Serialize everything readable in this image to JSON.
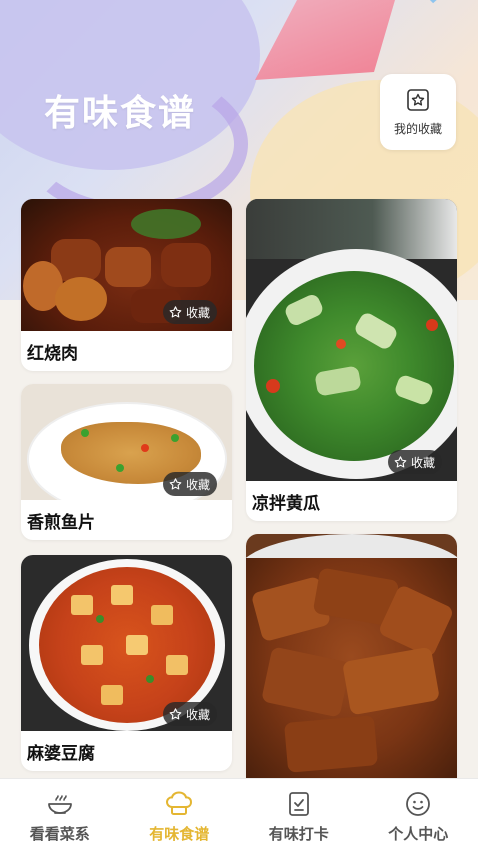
{
  "header": {
    "title": "有味食谱",
    "favorites_label": "我的收藏"
  },
  "recipes": [
    {
      "name": "红烧肉",
      "badge": "收藏"
    },
    {
      "name": "凉拌黄瓜",
      "badge": "收藏"
    },
    {
      "name": "香煎鱼片",
      "badge": "收藏"
    },
    {
      "name": "麻婆豆腐",
      "badge": "收藏"
    },
    {
      "name": "",
      "badge": ""
    }
  ],
  "tabs": [
    {
      "label": "看看菜系",
      "icon": "bowl-icon",
      "active": false
    },
    {
      "label": "有味食谱",
      "icon": "chef-hat-icon",
      "active": true
    },
    {
      "label": "有味打卡",
      "icon": "checklist-icon",
      "active": false
    },
    {
      "label": "个人中心",
      "icon": "smiley-icon",
      "active": false
    }
  ],
  "colors": {
    "accent": "#e4b632",
    "tab_inactive": "#555555",
    "badge_bg": "#282828"
  }
}
